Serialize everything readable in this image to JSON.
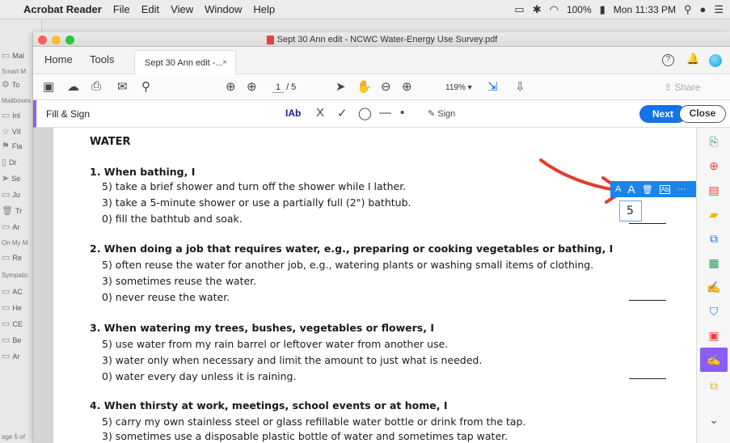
{
  "menubar": {
    "app": "Acrobat Reader",
    "items": [
      "File",
      "Edit",
      "View",
      "Window",
      "Help"
    ],
    "battery": "100%",
    "clock": "Mon 11:33 PM"
  },
  "mail": {
    "mailboxes_header": "Mailboxes",
    "smart_header": "Smart M",
    "on_my_mac": "On My M",
    "sympatico": "Sympatic",
    "rows": [
      "Mai",
      "To",
      "Inl",
      "VII",
      "Fla",
      "Dr",
      "Se",
      "Ju",
      "Tr",
      "Ar",
      "Re",
      "AC",
      "He",
      "CE",
      "Be",
      "Ar"
    ],
    "bottom_text": "age 5 of"
  },
  "window": {
    "title": "Sept 30 Ann edit - NCWC  Water-Energy Use Survey.pdf"
  },
  "tabs": {
    "home": "Home",
    "tools": "Tools",
    "doc": "Sept 30 Ann edit -...",
    "close": "×"
  },
  "toolbar": {
    "page_current": "1",
    "page_total": "/ 5",
    "zoom": "119%",
    "share": "Share"
  },
  "fillsign": {
    "label": "Fill & Sign",
    "text_tool": "Ab",
    "cross": "X",
    "check": "✓",
    "sign": "Sign",
    "next": "Next",
    "close": "Close"
  },
  "document": {
    "heading": "WATER",
    "q1": "1. When bathing, I",
    "q1_a": "5) take a brief shower and turn off the shower while I lather.",
    "q1_b": "3) take a 5-minute shower or use a partially full (2\") bathtub.",
    "q1_c": "0) fill the bathtub and soak.",
    "q1_answer": "5",
    "q2": "2. When doing a job that requires water, e.g., preparing or cooking vegetables or bathing, I",
    "q2_a": "5) often reuse the water for another job, e.g., watering plants or washing small items of clothing.",
    "q2_b": "3) sometimes reuse the water.",
    "q2_c": "0) never reuse the water.",
    "q3": "3. When watering my trees, bushes, vegetables or flowers, I",
    "q3_a": "5)  use water from my rain barrel or leftover water from another use.",
    "q3_b": "3) water only when necessary and limit the amount to just what is needed.",
    "q3_c": "0) water every day unless it is raining.",
    "q4": "4. When thirsty at work, meetings, school events or at home, I",
    "q4_a": "5) carry my own stainless steel or glass refillable water bottle or drink from the tap.",
    "q4_b": "3) sometimes use a disposable plastic bottle of water and sometimes tap water."
  },
  "field_toolbar": {
    "small_a": "A",
    "big_a": "A",
    "more": "···"
  },
  "colors": {
    "accent": "#1473e6",
    "fill_sign": "#8b5cf6",
    "arrow": "#e53b2c"
  }
}
